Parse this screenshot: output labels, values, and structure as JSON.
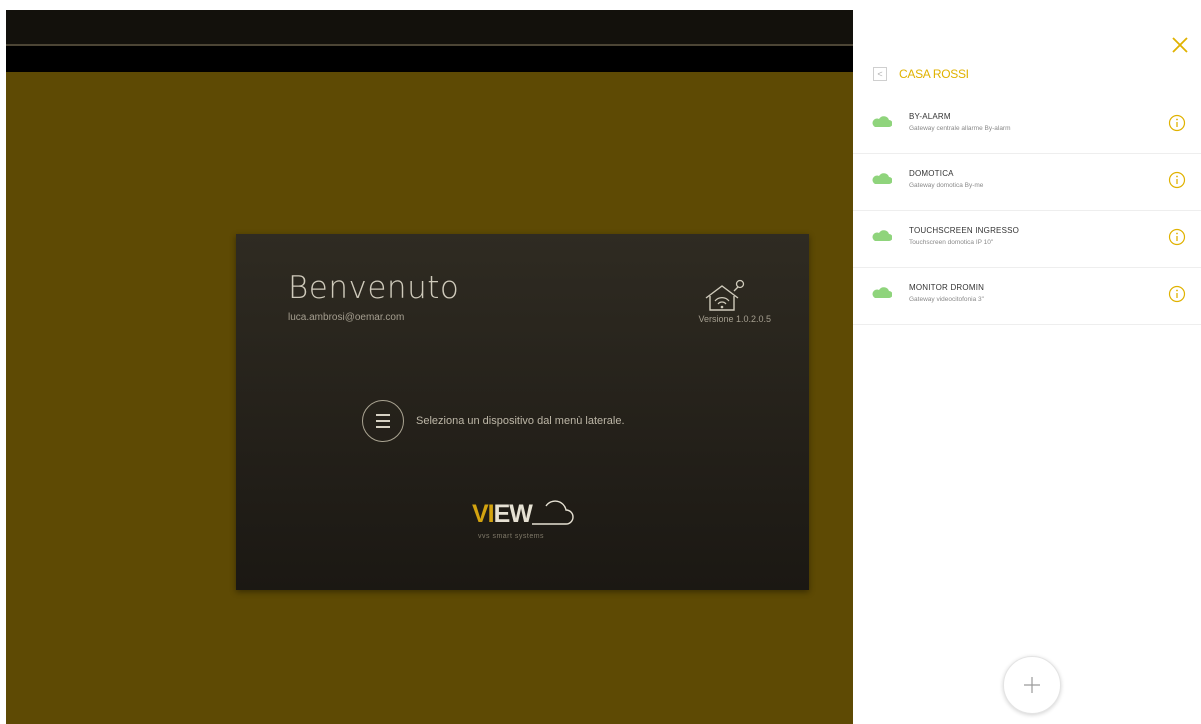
{
  "welcome": {
    "title": "Benvenuto",
    "email": "luca.ambrosi@oemar.com",
    "version": "Versione 1.0.2.0.5",
    "menu_hint": "Seleziona un dispositivo dal menù laterale.",
    "logo_vi": "VI",
    "logo_ew": "EW",
    "logo_tagline": "vvs smart systems"
  },
  "panel": {
    "site_name": "CASA ROSSI",
    "back_glyph": "<",
    "add_icon": "plus-icon",
    "close_icon": "close-icon"
  },
  "devices": [
    {
      "name": "BY-ALARM",
      "description": "Gateway centrale allarme By-alarm",
      "status": "online"
    },
    {
      "name": "DOMOTICA",
      "description": "Gateway domotica By-me",
      "status": "online"
    },
    {
      "name": "TOUCHSCREEN INGRESSO",
      "description": "Touchscreen domotica IP 10\"",
      "status": "online"
    },
    {
      "name": "MONITOR DROMIN",
      "description": "Gateway videocitofonia 3\"",
      "status": "online"
    }
  ],
  "colors": {
    "accent": "#e0b200",
    "app_background": "#5e4a04",
    "online_cloud": "#8fd47c",
    "card_background": "#2a261e"
  }
}
